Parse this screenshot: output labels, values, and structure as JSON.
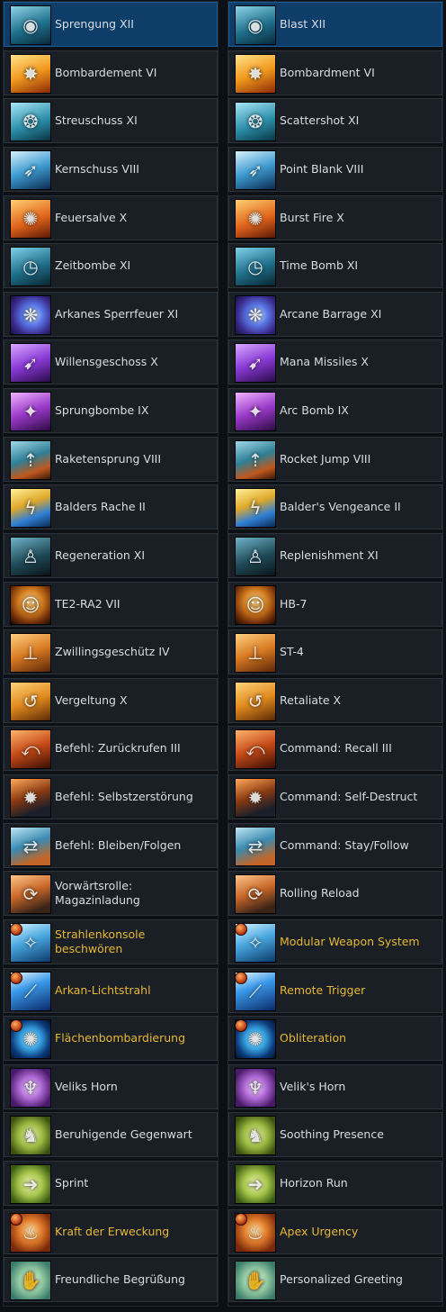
{
  "colors": {
    "row_bg": "#1a1f26",
    "selected_bg": "#0e3d6a",
    "text": "#d9dde2",
    "ultimate_text": "#e8b832"
  },
  "rows": [
    {
      "de": "Sprengung XII",
      "en": "Blast XII",
      "icon": "grenade-icon",
      "grad": "linear-gradient(160deg,#8fd3e6,#1e6f8c 55%,#0a2a3a)",
      "glyph": "◉",
      "gold": false,
      "badge": false,
      "selected": true
    },
    {
      "de": "Bombardement VI",
      "en": "Bombardment VI",
      "icon": "fire-burst-icon",
      "grad": "linear-gradient(160deg,#ffe28a,#f29a1e 50%,#8a2a05)",
      "glyph": "✸",
      "gold": false,
      "badge": false
    },
    {
      "de": "Streuschuss XI",
      "en": "Scattershot XI",
      "icon": "scattershot-icon",
      "grad": "linear-gradient(160deg,#a9e6f5,#2c8fab 55%,#0a3442)",
      "glyph": "❂",
      "gold": false,
      "badge": false
    },
    {
      "de": "Kernschuss VIII",
      "en": "Point Blank VIII",
      "icon": "point-blank-icon",
      "grad": "linear-gradient(160deg,#d8f1fb,#3e9bd0 50%,#0b2c52)",
      "glyph": "➶",
      "gold": false,
      "badge": false
    },
    {
      "de": "Feuersalve X",
      "en": "Burst Fire X",
      "icon": "burst-fire-icon",
      "grad": "linear-gradient(160deg,#ffd070,#e0641c 55%,#5a1805)",
      "glyph": "✺",
      "gold": false,
      "badge": false
    },
    {
      "de": "Zeitbombe XI",
      "en": "Time Bomb XI",
      "icon": "time-bomb-icon",
      "grad": "linear-gradient(160deg,#7fd1e8,#1f6e8a 55%,#0a2530)",
      "glyph": "◷",
      "gold": false,
      "badge": false
    },
    {
      "de": "Arkanes Sperrfeuer XI",
      "en": "Arcane Barrage XI",
      "icon": "arcane-vortex-icon",
      "grad": "radial-gradient(circle at 55% 50%,#cfe9ff,#5a78e8 35%,#3a2a8a 70%,#1a1040)",
      "glyph": "❋",
      "gold": false,
      "badge": false
    },
    {
      "de": "Willensgeschoss X",
      "en": "Mana Missiles X",
      "icon": "mana-missiles-icon",
      "grad": "linear-gradient(160deg,#d9a8ff,#8a3ad6 50%,#2a0b4a)",
      "glyph": "➹",
      "gold": false,
      "badge": false
    },
    {
      "de": "Sprungbombe IX",
      "en": "Arc Bomb IX",
      "icon": "arc-bomb-icon",
      "grad": "linear-gradient(160deg,#f0b3ff,#9a3ac8 50%,#2e0a44)",
      "glyph": "✦",
      "gold": false,
      "badge": false
    },
    {
      "de": "Raketensprung VIII",
      "en": "Rocket Jump VIII",
      "icon": "rocket-jump-icon",
      "grad": "linear-gradient(160deg,#9fd8e8,#2f7f96 45%,#c0581e 75%,#3a1a08)",
      "glyph": "⇡",
      "gold": false,
      "badge": false
    },
    {
      "de": "Balders Rache II",
      "en": "Balder's Vengeance II",
      "icon": "lightning-icon",
      "grad": "linear-gradient(160deg,#fff29a,#e0a92a 40%,#2f7fd6 70%,#0b2a52)",
      "glyph": "ϟ",
      "gold": false,
      "badge": false
    },
    {
      "de": "Regeneration XI",
      "en": "Replenishment XI",
      "icon": "replenish-icon",
      "grad": "linear-gradient(160deg,#6fb3c8,#1f4a58 55%,#0a1418)",
      "glyph": "♙",
      "gold": false,
      "badge": false
    },
    {
      "de": "TE2-RA2 VII",
      "en": "HB-7",
      "icon": "robot-icon",
      "grad": "radial-gradient(circle at 50% 40%,#ffd98a,#d07a1e 40%,#6a2a08 75%,#1a0a02)",
      "glyph": "☺",
      "gold": false,
      "badge": false
    },
    {
      "de": "Zwillingsgeschütz IV",
      "en": "ST-4",
      "icon": "turret-icon",
      "grad": "linear-gradient(160deg,#ffcf80,#d87a22 50%,#5a2608)",
      "glyph": "⊥",
      "gold": false,
      "badge": false
    },
    {
      "de": "Vergeltung X",
      "en": "Retaliate X",
      "icon": "retaliate-icon",
      "grad": "linear-gradient(160deg,#ffd37a,#e08a1e 50%,#5a2a06)",
      "glyph": "↺",
      "gold": false,
      "badge": false
    },
    {
      "de": "Befehl: Zurückrufen III",
      "en": "Command: Recall III",
      "icon": "recall-icon",
      "grad": "linear-gradient(160deg,#ffb36a,#c44a18 50%,#3a0e04)",
      "glyph": "⤺",
      "gold": false,
      "badge": false
    },
    {
      "de": "Befehl: Selbstzerstörung",
      "en": "Command: Self-Destruct",
      "icon": "self-destruct-icon",
      "grad": "linear-gradient(160deg,#ffaa5a,#8a3a12 45%,#1a1f2a 80%)",
      "glyph": "✹",
      "gold": false,
      "badge": false
    },
    {
      "de": "Befehl: Bleiben/Folgen",
      "en": "Command: Stay/Follow",
      "icon": "stay-follow-icon",
      "grad": "linear-gradient(160deg,#bfe6f5,#3a8ab0 45%,#c0662a 80%)",
      "glyph": "⇄",
      "gold": false,
      "badge": false
    },
    {
      "de": "Vorwärtsrolle: Magazinladung",
      "en": "Rolling Reload",
      "icon": "rolling-reload-icon",
      "grad": "linear-gradient(160deg,#ffc58a,#c8682a 45%,#3a2418 85%)",
      "glyph": "⟳",
      "gold": false,
      "badge": false
    },
    {
      "de": "Strahlenkonsole beschwören",
      "en": "Modular Weapon System",
      "icon": "weapon-system-icon",
      "grad": "linear-gradient(160deg,#d6f3ff,#4aa8e0 45%,#0b3a6a)",
      "glyph": "✧",
      "gold": true,
      "badge": true
    },
    {
      "de": "Arkan-Lichtstrahl",
      "en": "Remote Trigger",
      "icon": "light-beam-icon",
      "grad": "linear-gradient(160deg,#e8f8ff,#3a9ae8 40%,#0b2a6a)",
      "glyph": "⟋",
      "gold": true,
      "badge": true
    },
    {
      "de": "Flächenbombardierung",
      "en": "Obliteration",
      "icon": "obliteration-icon",
      "grad": "radial-gradient(circle at 50% 50%,#e8fbff,#3aa8e8 35%,#0b3a7a 70%,#04142a)",
      "glyph": "✺",
      "gold": true,
      "badge": true
    },
    {
      "de": "Veliks Horn",
      "en": "Velik's Horn",
      "icon": "horn-icon",
      "grad": "radial-gradient(circle at 50% 50%,#f4d9ff,#b06ad6 40%,#4a1a6a 80%)",
      "glyph": "♆",
      "gold": false,
      "badge": false
    },
    {
      "de": "Beruhigende Gegenwart",
      "en": "Soothing Presence",
      "icon": "soothing-presence-icon",
      "grad": "radial-gradient(circle at 50% 50%,#eaf5b0,#9ab840 45%,#3a5010 85%)",
      "glyph": "♞",
      "gold": false,
      "badge": false
    },
    {
      "de": "Sprint",
      "en": "Horizon Run",
      "icon": "sprint-icon",
      "grad": "radial-gradient(circle at 50% 50%,#f0f8b8,#a2c248 45%,#3a5a12 85%)",
      "glyph": "➜",
      "gold": false,
      "badge": false
    },
    {
      "de": "Kraft der Erweckung",
      "en": "Apex Urgency",
      "icon": "apex-urgency-icon",
      "grad": "radial-gradient(circle at 50% 45%,#ffe0a0,#e07a2a 40%,#7a2a0a 80%)",
      "glyph": "♨",
      "gold": true,
      "badge": true
    },
    {
      "de": "Freundliche Begrüßung",
      "en": "Personalized Greeting",
      "icon": "greeting-icon",
      "grad": "radial-gradient(circle at 50% 50%,#f0fbe0,#9ad0a8 40%,#3a7a6a 85%)",
      "glyph": "✋",
      "gold": false,
      "badge": false
    }
  ]
}
